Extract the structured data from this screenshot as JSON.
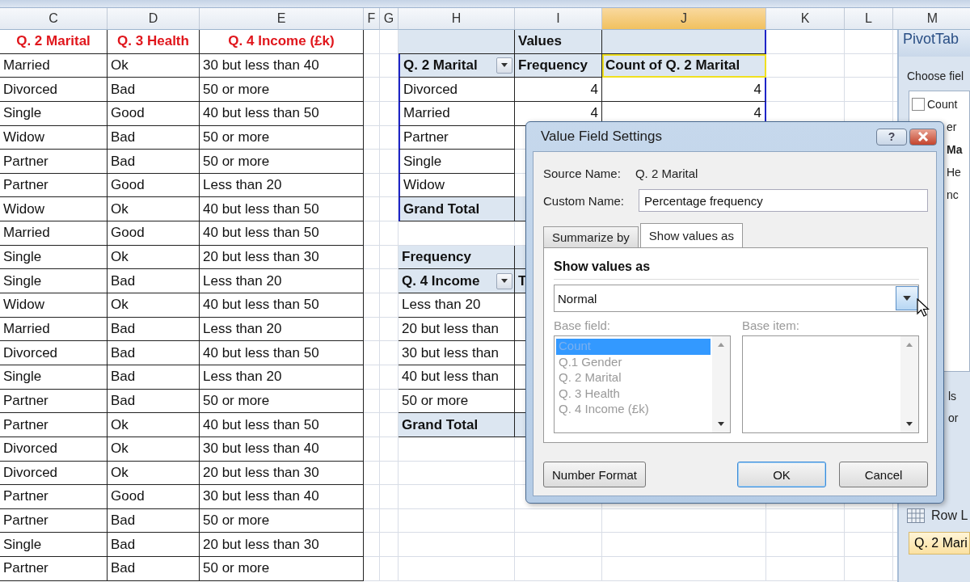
{
  "sheet": {
    "columns": [
      {
        "label": "C",
        "selected": false
      },
      {
        "label": "D",
        "selected": false
      },
      {
        "label": "E",
        "selected": false
      },
      {
        "label": "F",
        "selected": false
      },
      {
        "label": "G",
        "selected": false
      },
      {
        "label": "H",
        "selected": false
      },
      {
        "label": "I",
        "selected": false
      },
      {
        "label": "J",
        "selected": true
      },
      {
        "label": "K",
        "selected": false
      },
      {
        "label": "L",
        "selected": false
      },
      {
        "label": "M",
        "selected": false
      }
    ]
  },
  "data_table": {
    "headers": [
      "Q. 2 Marital",
      "Q. 3 Health",
      "Q. 4 Income (£k)"
    ],
    "rows": [
      [
        "Married",
        "Ok",
        "30 but less than 40"
      ],
      [
        "Divorced",
        "Bad",
        "50 or more"
      ],
      [
        "Single",
        "Good",
        "40 but less than 50"
      ],
      [
        "Widow",
        "Bad",
        "50 or more"
      ],
      [
        "Partner",
        "Bad",
        "50 or more"
      ],
      [
        "Partner",
        "Good",
        "Less than 20"
      ],
      [
        "Widow",
        "Ok",
        "40 but less than 50"
      ],
      [
        "Married",
        "Good",
        "40 but less than 50"
      ],
      [
        "Single",
        "Ok",
        "20 but less than 30"
      ],
      [
        "Single",
        "Bad",
        "Less than 20"
      ],
      [
        "Widow",
        "Ok",
        "40 but less than 50"
      ],
      [
        "Married",
        "Bad",
        "Less than 20"
      ],
      [
        "Divorced",
        "Bad",
        "40 but less than 50"
      ],
      [
        "Single",
        "Bad",
        "Less than 20"
      ],
      [
        "Partner",
        "Bad",
        "50 or more"
      ],
      [
        "Partner",
        "Ok",
        "40 but less than 50"
      ],
      [
        "Divorced",
        "Ok",
        "30 but less than 40"
      ],
      [
        "Divorced",
        "Ok",
        "20 but less than 30"
      ],
      [
        "Partner",
        "Good",
        "30 but less than 40"
      ],
      [
        "Partner",
        "Bad",
        "50 or more"
      ],
      [
        "Single",
        "Bad",
        "20 but less than 30"
      ],
      [
        "Partner",
        "Bad",
        "50 or more"
      ]
    ]
  },
  "pivot_1": {
    "values_label": "Values",
    "row_field": "Q. 2 Marital",
    "columns": [
      {
        "label": "Frequency",
        "selected": false
      },
      {
        "label": "Count of Q. 2 Marital",
        "selected": true
      }
    ],
    "rows": [
      {
        "label": "Divorced",
        "values": [
          "4",
          "4"
        ]
      },
      {
        "label": "Married",
        "values": [
          "4",
          "4"
        ]
      },
      {
        "label": "Partner"
      },
      {
        "label": "Single"
      },
      {
        "label": "Widow"
      }
    ],
    "grand_total": "Grand Total"
  },
  "pivot_2": {
    "title": "Frequency",
    "row_field": "Q. 4 Income",
    "column_2": "T",
    "rows": [
      "Less than 20",
      "20 but less than",
      "30 but less than",
      "40 but less than",
      "50 or more"
    ],
    "grand_total": "Grand Total"
  },
  "field_list_panel": {
    "title": "PivotTab",
    "prompt": "Choose fiel",
    "fields": [
      {
        "label": "Count",
        "checked": false
      },
      {
        "label": "er"
      },
      {
        "label": "Ma"
      },
      {
        "label": "He"
      },
      {
        "label": "nc"
      }
    ],
    "area_fragments": [
      "ls",
      "or"
    ],
    "row_labels_title": "Row L",
    "row_label_item": "Q. 2 Mari"
  },
  "dialog": {
    "title": "Value Field Settings",
    "help": "?",
    "source_name_label": "Source Name:",
    "source_name": "Q. 2 Marital",
    "custom_name_label": "Custom Name:",
    "custom_name": "Percentage frequency",
    "tabs": [
      {
        "label": "Summarize by",
        "selected": false
      },
      {
        "label": "Show values as",
        "selected": true
      }
    ],
    "group_title": "Show values as",
    "show_values_as": "Normal",
    "base_field": {
      "label": "Base field:",
      "disabled": true,
      "items": [
        {
          "label": "Count",
          "selected": true
        },
        {
          "label": "Q.1 Gender",
          "selected": false
        },
        {
          "label": "Q. 2 Marital",
          "selected": false
        },
        {
          "label": "Q. 3 Health",
          "selected": false
        },
        {
          "label": "Q. 4 Income (£k)",
          "selected": false
        }
      ]
    },
    "base_item": {
      "label": "Base item:",
      "disabled": true
    },
    "buttons": [
      {
        "label": "Number Format",
        "kind": "secondary"
      },
      {
        "label": "OK",
        "kind": "default"
      },
      {
        "label": "Cancel",
        "kind": "secondary"
      }
    ]
  }
}
